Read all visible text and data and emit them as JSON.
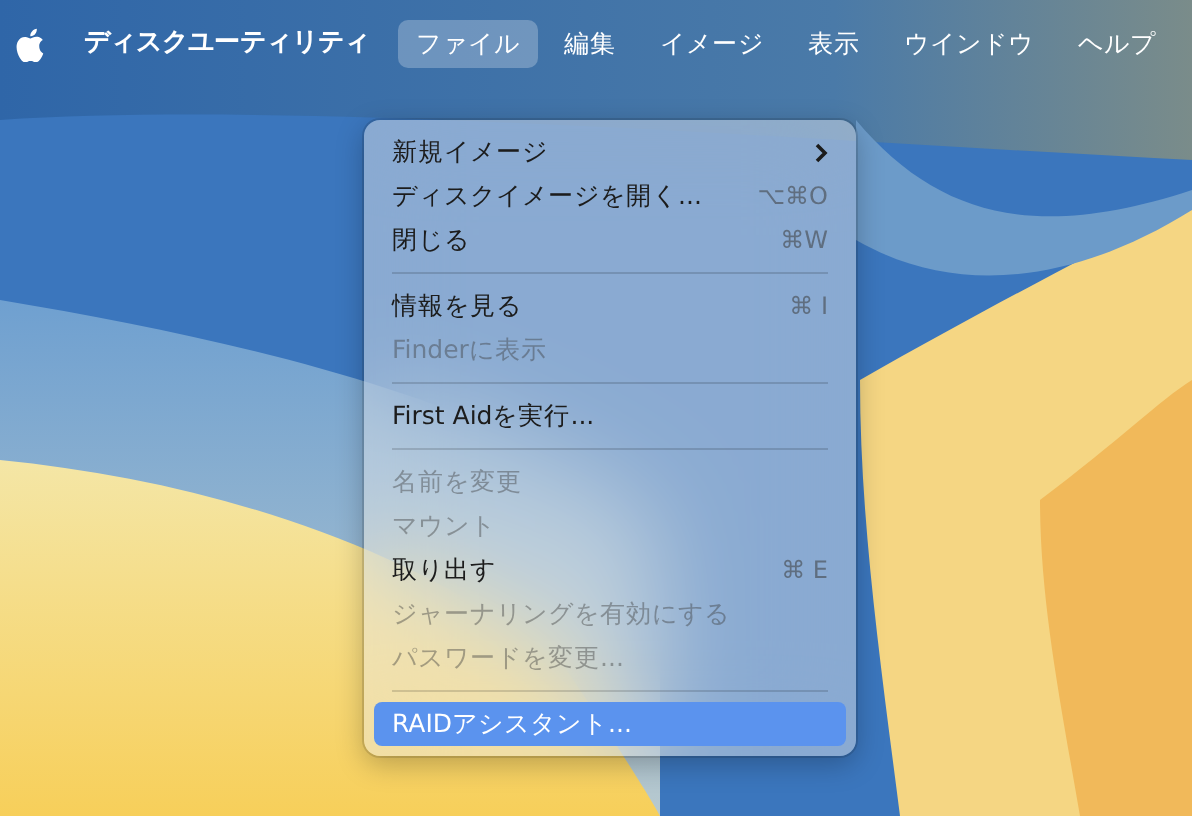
{
  "menu_bar": {
    "app_name": "ディスクユーティリティ",
    "menus": [
      {
        "label": "ファイル",
        "selected": true
      },
      {
        "label": "編集",
        "selected": false
      },
      {
        "label": "イメージ",
        "selected": false
      },
      {
        "label": "表示",
        "selected": false
      },
      {
        "label": "ウインドウ",
        "selected": false
      },
      {
        "label": "ヘルプ",
        "selected": false
      }
    ]
  },
  "dropdown": {
    "items": [
      {
        "kind": "item",
        "label": "新規イメージ",
        "submenu": true,
        "disabled": false,
        "selected": false
      },
      {
        "kind": "item",
        "label": "ディスクイメージを開く...",
        "shortcut": "⌥⌘O",
        "disabled": false,
        "selected": false
      },
      {
        "kind": "item",
        "label": "閉じる",
        "shortcut": "⌘W",
        "disabled": false,
        "selected": false
      },
      {
        "kind": "separator"
      },
      {
        "kind": "item",
        "label": "情報を見る",
        "shortcut": "⌘ I",
        "disabled": false,
        "selected": false
      },
      {
        "kind": "item",
        "label": "Finderに表示",
        "disabled": true,
        "selected": false
      },
      {
        "kind": "separator"
      },
      {
        "kind": "item",
        "label": "First Aidを実行...",
        "disabled": false,
        "selected": false
      },
      {
        "kind": "separator"
      },
      {
        "kind": "item",
        "label": "名前を変更",
        "disabled": true,
        "selected": false
      },
      {
        "kind": "item",
        "label": "マウント",
        "disabled": true,
        "selected": false
      },
      {
        "kind": "item",
        "label": "取り出す",
        "shortcut": "⌘ E",
        "disabled": false,
        "selected": false
      },
      {
        "kind": "item",
        "label": "ジャーナリングを有効にする",
        "disabled": true,
        "selected": false
      },
      {
        "kind": "item",
        "label": "パスワードを変更...",
        "disabled": true,
        "selected": false
      },
      {
        "kind": "separator"
      },
      {
        "kind": "item",
        "label": "RAIDアシスタント...",
        "disabled": false,
        "selected": true
      }
    ]
  }
}
